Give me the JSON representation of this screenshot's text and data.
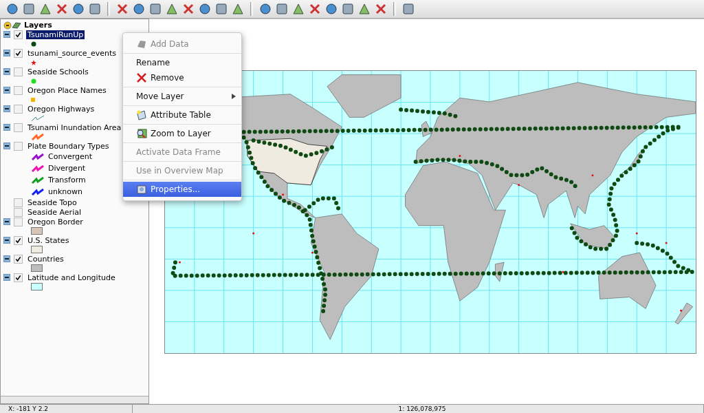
{
  "toc": {
    "title": "Layers",
    "layers": [
      {
        "name": "TsunamiRunUp",
        "checked": true,
        "expanded": true,
        "selected": true,
        "legend": {
          "kind": "circle",
          "color": "#0f4a12"
        }
      },
      {
        "name": "tsunami_source_events",
        "checked": true,
        "expanded": true,
        "selected": false,
        "legend": {
          "kind": "star",
          "color": "#e01010"
        }
      },
      {
        "name": "Seaside Schools",
        "checked": false,
        "expanded": true,
        "selected": false,
        "legend": {
          "kind": "circle",
          "color": "#22dd22"
        }
      },
      {
        "name": "Oregon Place Names",
        "checked": false,
        "expanded": true,
        "selected": false,
        "legend": {
          "kind": "square",
          "color": "#f4b400"
        }
      },
      {
        "name": "Oregon Highways",
        "checked": false,
        "expanded": true,
        "selected": false,
        "legend": {
          "kind": "line",
          "color": "#3d8f8f"
        }
      },
      {
        "name": "Tsunami Inundation Area",
        "checked": false,
        "expanded": true,
        "selected": false,
        "legend": {
          "kind": "zigzag",
          "color": "#ff6a2a"
        }
      },
      {
        "name": "Plate Boundary Types",
        "checked": false,
        "expanded": true,
        "selected": false,
        "classes": [
          {
            "label": "Convergent",
            "color": "#9a10c8"
          },
          {
            "label": "Divergent",
            "color": "#f010b0"
          },
          {
            "label": "Transform",
            "color": "#10a020"
          },
          {
            "label": "unknown",
            "color": "#1020f0"
          }
        ]
      },
      {
        "name": "Seaside Topo",
        "checked": false,
        "selected": false
      },
      {
        "name": "Seaside Aerial",
        "checked": false,
        "selected": false
      },
      {
        "name": "Oregon Border",
        "checked": false,
        "expanded": true,
        "selected": false,
        "legend": {
          "kind": "fill",
          "color": "#d6c4b6"
        }
      },
      {
        "name": "U.S. States",
        "checked": true,
        "expanded": true,
        "selected": false,
        "legend": {
          "kind": "fill",
          "color": "#f0ebe0"
        }
      },
      {
        "name": "Countries",
        "checked": true,
        "expanded": true,
        "selected": false,
        "legend": {
          "kind": "fill",
          "color": "#bdbdbd"
        }
      },
      {
        "name": "Latitude and Longitude",
        "checked": true,
        "expanded": true,
        "selected": false,
        "legend": {
          "kind": "fill",
          "color": "#c8ffff"
        }
      }
    ]
  },
  "context_menu": {
    "groups": [
      [
        {
          "label": "Add Data",
          "disabled": true,
          "selected": false
        }
      ],
      [
        {
          "label": "Rename",
          "disabled": false,
          "selected": false
        },
        {
          "label": "Remove",
          "disabled": false,
          "selected": false
        }
      ],
      [
        {
          "label": "Move Layer",
          "disabled": false,
          "selected": false,
          "submenu": true
        }
      ],
      [
        {
          "label": "Attribute Table",
          "disabled": false,
          "selected": false
        }
      ],
      [
        {
          "label": "Zoom to Layer",
          "disabled": false,
          "selected": false
        }
      ],
      [
        {
          "label": "Activate Data Frame",
          "disabled": true,
          "selected": false
        }
      ],
      [
        {
          "label": "Use in Overview Map",
          "disabled": true,
          "selected": false
        }
      ],
      [
        {
          "label": "Properties...",
          "disabled": false,
          "selected": true
        }
      ]
    ]
  },
  "status_bar": {
    "coordinates": "X: -181 Y 2.2",
    "scale": "1: 126,078,975"
  }
}
